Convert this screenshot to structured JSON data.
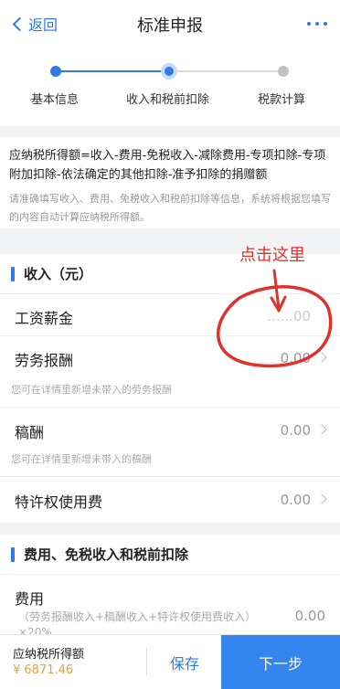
{
  "header": {
    "back_label": "返回",
    "title": "标准申报"
  },
  "steps": [
    {
      "label": "基本信息",
      "state": "done"
    },
    {
      "label": "收入和税前扣除",
      "state": "current"
    },
    {
      "label": "税款计算",
      "state": "todo"
    }
  ],
  "formula": {
    "text": "应纳税所得额=收入-费用-免税收入-减除费用-专项扣除-专项附加扣除-依法确定的其他扣除-准予扣除的捐赠额",
    "hint": "请准确填写收入、费用、免税收入和税前扣除等信息，系统将根据您填写的内容自动计算应纳税所得额。"
  },
  "income": {
    "title": "收入（元）",
    "rows": [
      {
        "label": "工资薪金",
        "value": "......00",
        "hint": ""
      },
      {
        "label": "劳务报酬",
        "value": "0.00",
        "hint": "您可在详情里新增未带入的劳务报酬"
      },
      {
        "label": "稿酬",
        "value": "0.00",
        "hint": "您可在详情里新增未带入的稿酬"
      },
      {
        "label": "特许权使用费",
        "value": "0.00",
        "hint": ""
      }
    ]
  },
  "deduction": {
    "title": "费用、免税收入和税前扣除",
    "fee_label": "费用",
    "fee_formula": "（劳务报酬收入+稿酬收入+特许权使用费收入）",
    "fee_rate": "×20%",
    "fee_value": "0.00"
  },
  "annotation": {
    "text": "点击这里"
  },
  "footer": {
    "tax_label": "应纳税所得额",
    "tax_value": "¥ 6871.46",
    "save_label": "保存",
    "next_label": "下一步"
  },
  "colors": {
    "accent": "#2f7ae5",
    "annotation": "#e0312d",
    "amount": "#e6a23c"
  }
}
